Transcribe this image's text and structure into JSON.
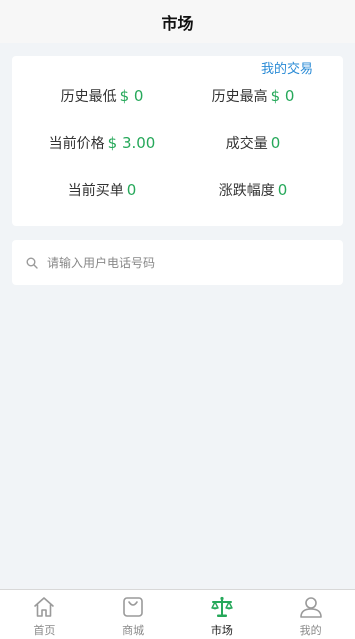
{
  "header": {
    "title": "市场"
  },
  "stats": {
    "my_trade_link": "我的交易",
    "historical_low": {
      "label": "历史最低",
      "value": "$ 0"
    },
    "historical_high": {
      "label": "历史最高",
      "value": "$ 0"
    },
    "current_price": {
      "label": "当前价格",
      "value": "$ 3.00"
    },
    "volume": {
      "label": "成交量",
      "value": "0"
    },
    "current_buy_orders": {
      "label": "当前买单",
      "value": "0"
    },
    "change_range": {
      "label": "涨跌幅度",
      "value": "0"
    }
  },
  "search": {
    "placeholder": "请输入用户电话号码",
    "value": ""
  },
  "tabbar": {
    "items": [
      {
        "label": "首页",
        "icon": "home-icon",
        "active": false
      },
      {
        "label": "商城",
        "icon": "shopping-bag-icon",
        "active": false
      },
      {
        "label": "市场",
        "icon": "scale-icon",
        "active": true
      },
      {
        "label": "我的",
        "icon": "user-icon",
        "active": false
      }
    ]
  },
  "colors": {
    "accent_green": "#26a85a",
    "link_blue": "#2a8bd6",
    "background": "#f1f4f7"
  }
}
